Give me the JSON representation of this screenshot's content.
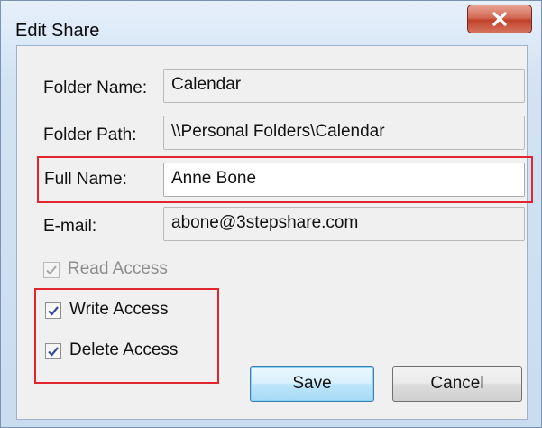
{
  "dialog": {
    "title": "Edit Share",
    "close_icon": "close-icon"
  },
  "form": {
    "folder_name_label": "Folder Name:",
    "folder_name_value": "Calendar",
    "folder_path_label": "Folder Path:",
    "folder_path_value": "\\\\Personal Folders\\Calendar",
    "full_name_label": "Full Name:",
    "full_name_value": "Anne Bone",
    "email_label": "E-mail:",
    "email_value": "abone@3stepshare.com"
  },
  "permissions": {
    "read_label": "Read Access",
    "read_checked": true,
    "read_enabled": false,
    "write_label": "Write Access",
    "write_checked": true,
    "delete_label": "Delete Access",
    "delete_checked": true
  },
  "buttons": {
    "save_label": "Save",
    "cancel_label": "Cancel"
  },
  "colors": {
    "highlight": "#e3262d",
    "close_button": "#c0412a",
    "default_button_border": "#3c7fb1"
  }
}
